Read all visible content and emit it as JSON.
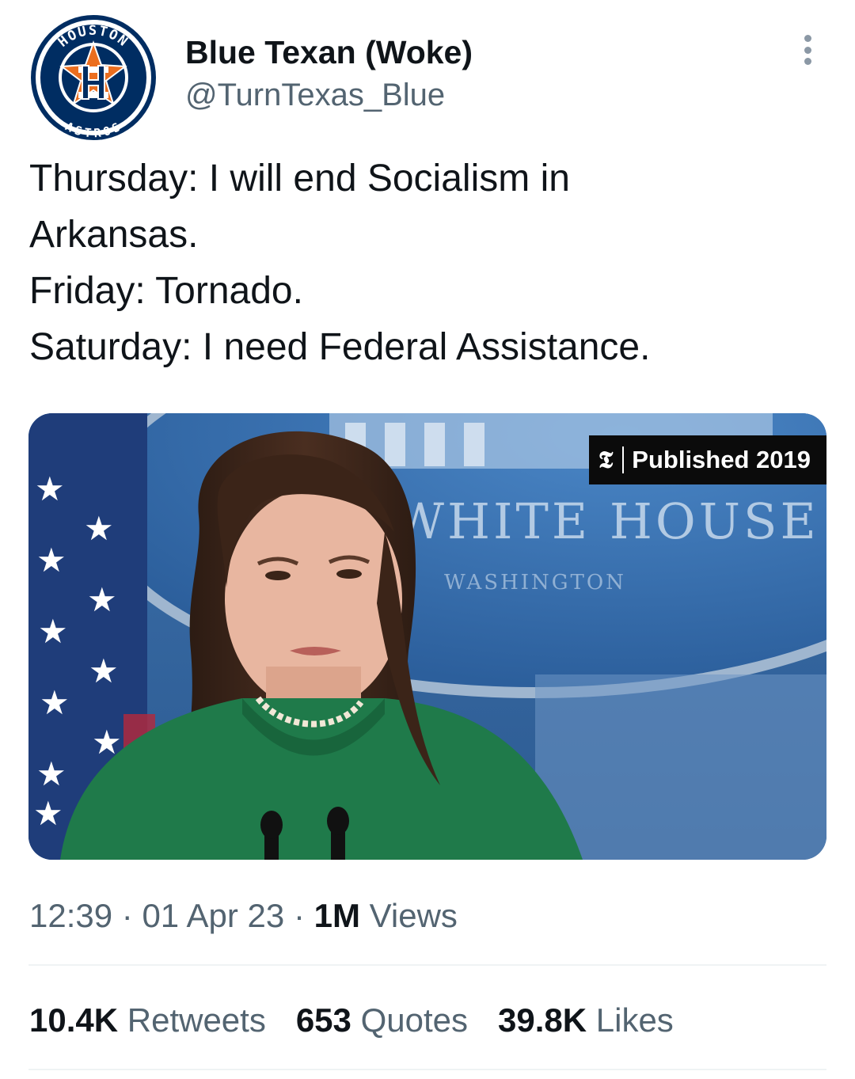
{
  "author": {
    "display_name": "Blue Texan (Woke)",
    "handle": "@TurnTexas_Blue",
    "avatar": {
      "logo_top_text": "HOUSTON",
      "logo_bottom_text": "ASTROS",
      "logo_letter": "H",
      "colors": {
        "navy": "#002d62",
        "orange": "#eb6e1f",
        "white": "#ffffff"
      }
    }
  },
  "tweet": {
    "lines": [
      "Thursday: I will end Socialism in",
      "Arkansas.",
      "Friday: Tornado.",
      "Saturday: I need Federal Assistance."
    ]
  },
  "media": {
    "badge_logo": "𝕿",
    "badge_text": "Published 2019",
    "sign_text": "WHITE HOUSE",
    "sign_subtext": "WASHINGTON"
  },
  "meta": {
    "time": "12:39",
    "date": "01 Apr 23",
    "views_count": "1M",
    "views_label": "Views",
    "separator": "·"
  },
  "stats": {
    "retweets_count": "10.4K",
    "retweets_label": "Retweets",
    "quotes_count": "653",
    "quotes_label": "Quotes",
    "likes_count": "39.8K",
    "likes_label": "Likes"
  },
  "colors": {
    "text_primary": "#0f1419",
    "text_secondary": "#536471",
    "divider": "#eff3f4"
  },
  "icons": {
    "more": "more-vertical-icon"
  }
}
